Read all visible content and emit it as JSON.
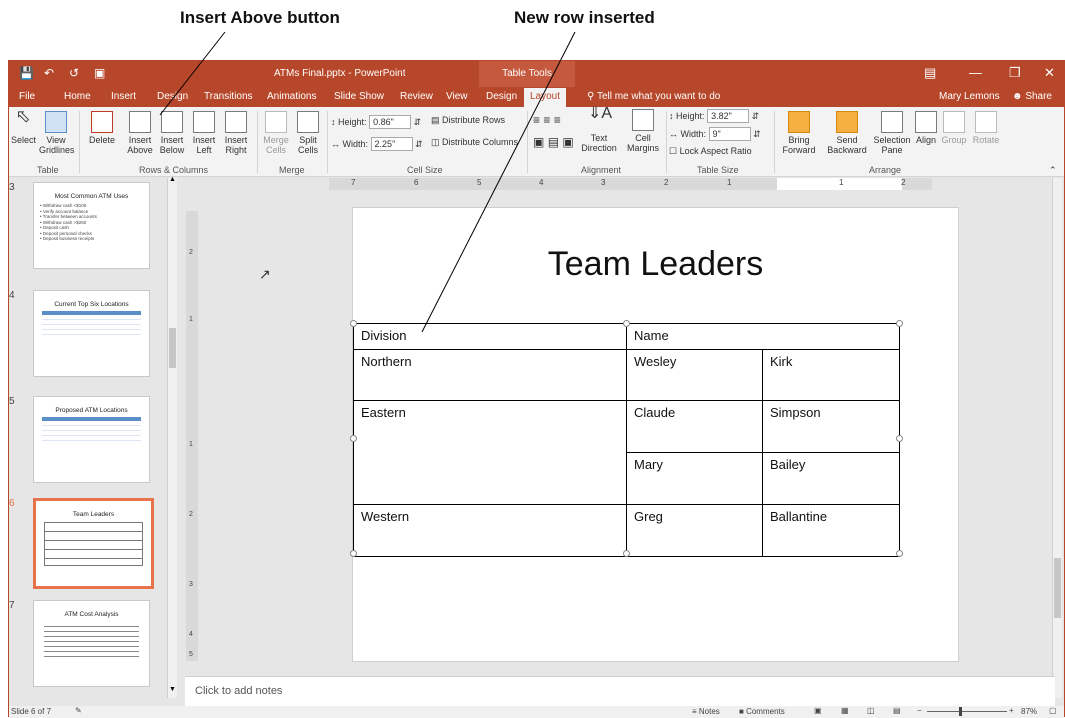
{
  "callouts": {
    "insert_above": "Insert Above button",
    "new_row": "New row inserted"
  },
  "titlebar": {
    "title": "ATMs Final.pptx - PowerPoint",
    "context": "Table Tools",
    "user": "Mary Lemons",
    "share": "Share"
  },
  "tabs": [
    "File",
    "Home",
    "Insert",
    "Design",
    "Transitions",
    "Animations",
    "Slide Show",
    "Review",
    "View",
    "Design",
    "Layout"
  ],
  "tell_me": "Tell me what you want to do",
  "ribbon": {
    "select": "Select",
    "view_gridlines": "View Gridlines",
    "delete": "Delete",
    "insert_above": "Insert Above",
    "insert_below": "Insert Below",
    "insert_left": "Insert Left",
    "insert_right": "Insert Right",
    "merge_cells": "Merge Cells",
    "split_cells": "Split Cells",
    "cell_height_label": "Height:",
    "cell_height": "0.86\"",
    "cell_width_label": "Width:",
    "cell_width": "2.25\"",
    "distribute_rows": "Distribute Rows",
    "distribute_columns": "Distribute Columns",
    "text_direction": "Text Direction",
    "cell_margins": "Cell Margins",
    "table_height_label": "Height:",
    "table_height": "3.82\"",
    "table_width_label": "Width:",
    "table_width": "9\"",
    "lock_aspect": "Lock Aspect Ratio",
    "bring_forward": "Bring Forward",
    "send_backward": "Send Backward",
    "selection_pane": "Selection Pane",
    "align": "Align",
    "group": "Group",
    "rotate": "Rotate",
    "groups": {
      "table": "Table",
      "rows_cols": "Rows & Columns",
      "merge": "Merge",
      "cell_size": "Cell Size",
      "alignment": "Alignment",
      "table_size": "Table Size",
      "arrange": "Arrange"
    }
  },
  "thumbs": [
    {
      "num": "3",
      "title": "Most Common ATM Uses",
      "bullets": [
        "Withdraw cash <$100",
        "Verify account balance",
        "Transfer between accounts",
        "Withdraw cash >$250",
        "Deposit cash",
        "Deposit personal checks",
        "Deposit business receipts"
      ]
    },
    {
      "num": "4",
      "title": "Current Top Six Locations"
    },
    {
      "num": "5",
      "title": "Proposed ATM Locations"
    },
    {
      "num": "6",
      "title": "Team Leaders"
    },
    {
      "num": "7",
      "title": "ATM Cost Analysis"
    }
  ],
  "ruler_h": [
    "7",
    "6",
    "5",
    "4",
    "3",
    "2",
    "1",
    "1",
    "2"
  ],
  "ruler_v": [
    "2",
    "1",
    "1",
    "2",
    "3",
    "4",
    "5"
  ],
  "slide": {
    "title": "Team Leaders",
    "rows": [
      [
        "Division",
        "Name",
        ""
      ],
      [
        "Northern",
        "Wesley",
        "Kirk"
      ],
      [
        "Eastern",
        "Claude",
        "Simpson"
      ],
      [
        "",
        "Mary",
        "Bailey"
      ],
      [
        "Western",
        "Greg",
        "Ballantine"
      ]
    ]
  },
  "notes": "Click to add notes",
  "status": {
    "slide": "Slide 6 of 7",
    "notes": "Notes",
    "comments": "Comments",
    "zoom": "87%"
  }
}
